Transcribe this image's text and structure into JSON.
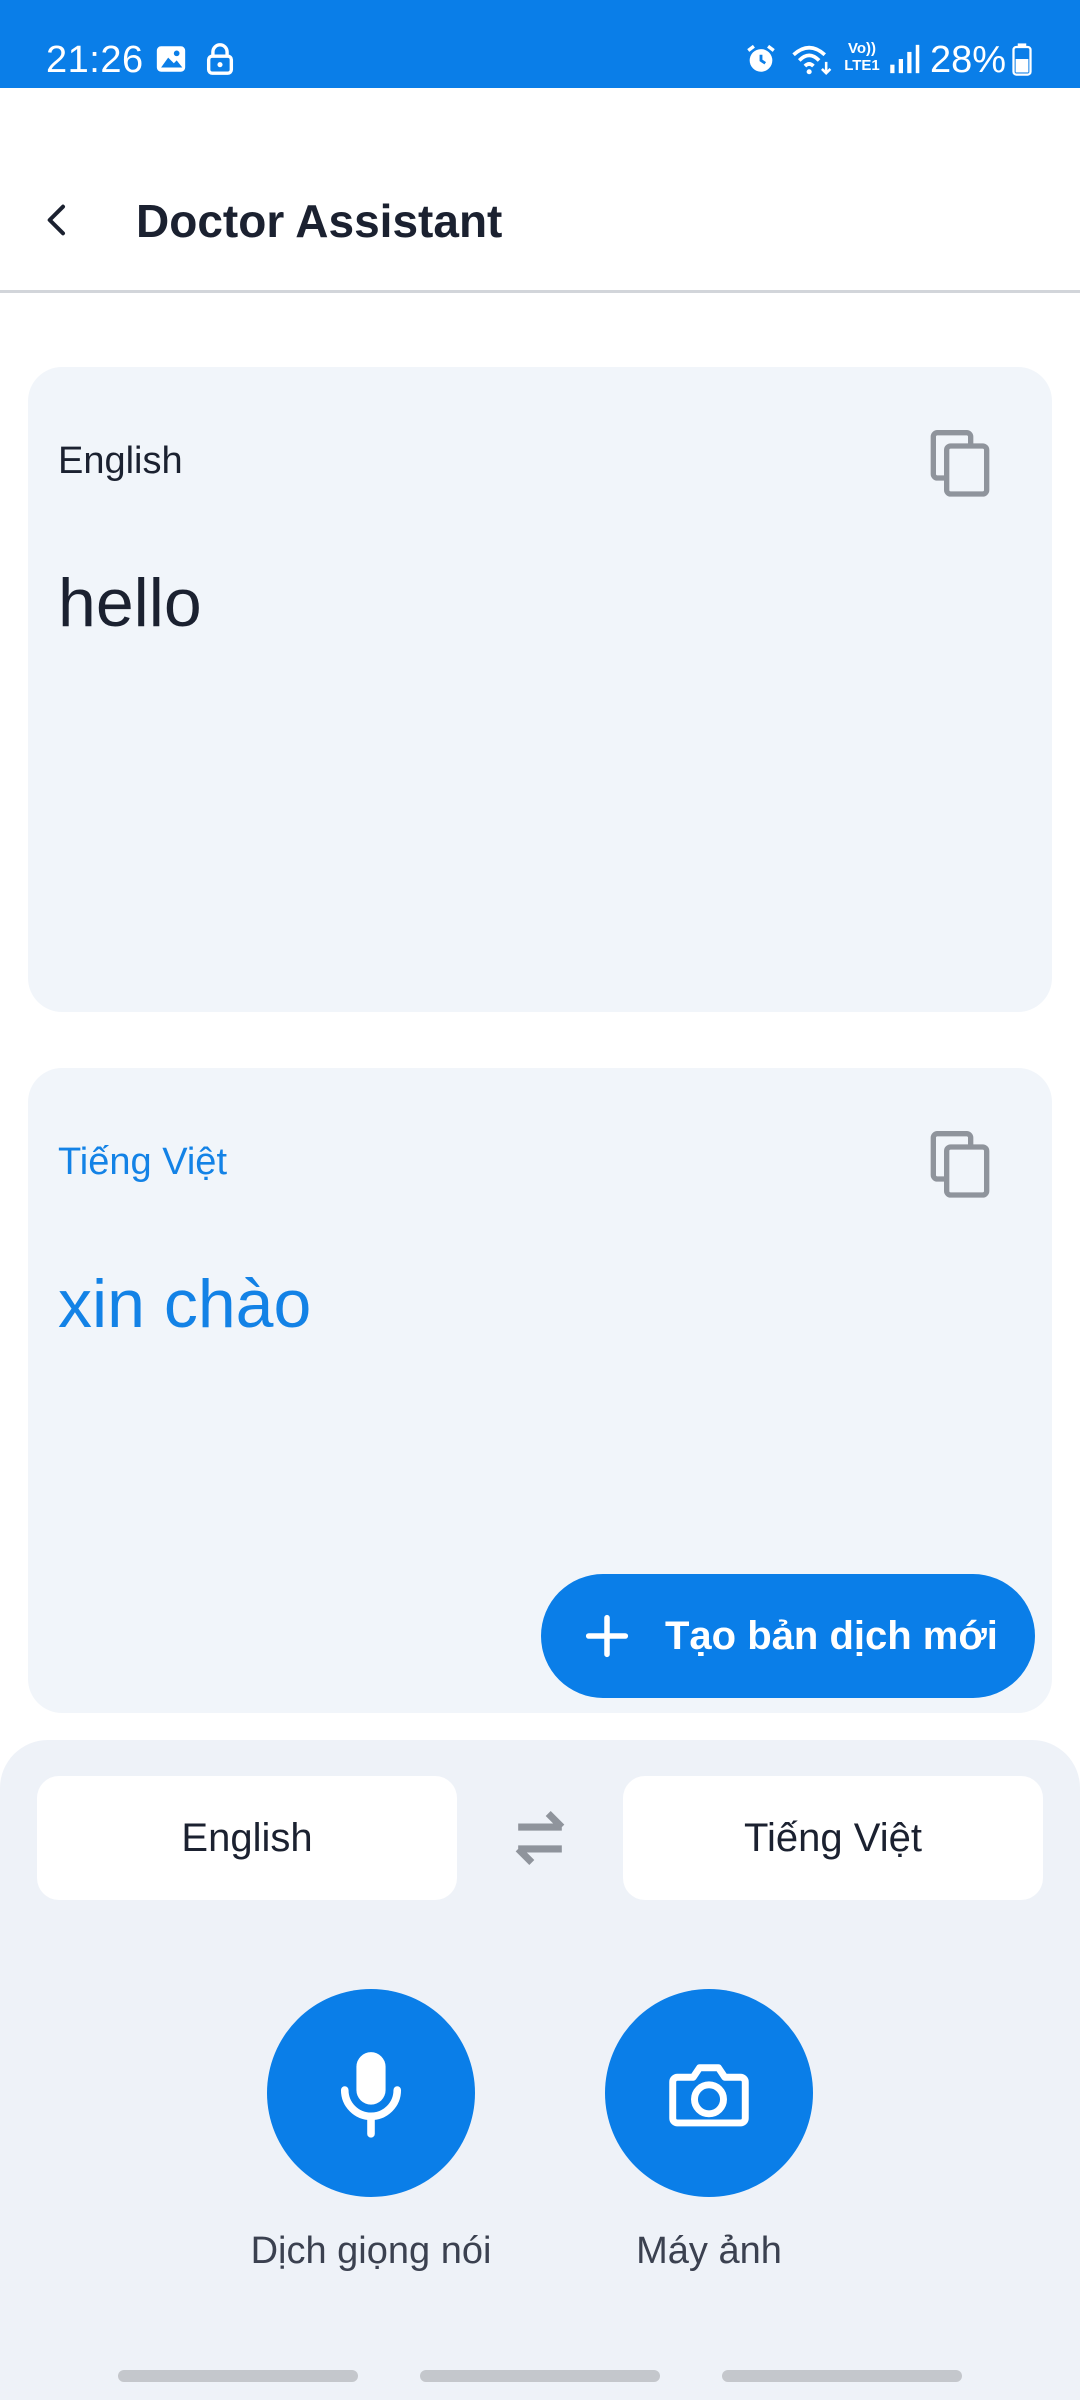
{
  "status_bar": {
    "time": "21:26",
    "battery": "28%",
    "background": "#0a7ee8",
    "icons": [
      "gallery-icon",
      "lock-icon",
      "alarm-icon",
      "wifi-icon",
      "volte-icon",
      "signal-icon",
      "battery-icon"
    ],
    "network_label_top": "Vo))",
    "network_label_bottom": "LTE1"
  },
  "app_bar": {
    "title": "Doctor Assistant",
    "back_icon": "chevron-left-icon"
  },
  "source_card": {
    "language": "English",
    "text": "hello",
    "copy_icon": "copy-icon"
  },
  "target_card": {
    "language": "Tiếng Việt",
    "text": "xin chào",
    "copy_icon": "copy-icon",
    "accent": "#1382e6"
  },
  "new_translation_button": {
    "label": "Tạo bản dịch mới",
    "icon": "plus-icon"
  },
  "language_bar": {
    "from": "English",
    "to": "Tiếng Việt",
    "swap_icon": "swap-icon"
  },
  "actions": [
    {
      "label": "Dịch giọng nói",
      "icon": "microphone-icon"
    },
    {
      "label": "Máy ảnh",
      "icon": "camera-icon"
    }
  ],
  "colors": {
    "primary": "#0a7ee8",
    "card_background": "#f1f5fa",
    "panel_background": "#eef2f8"
  }
}
